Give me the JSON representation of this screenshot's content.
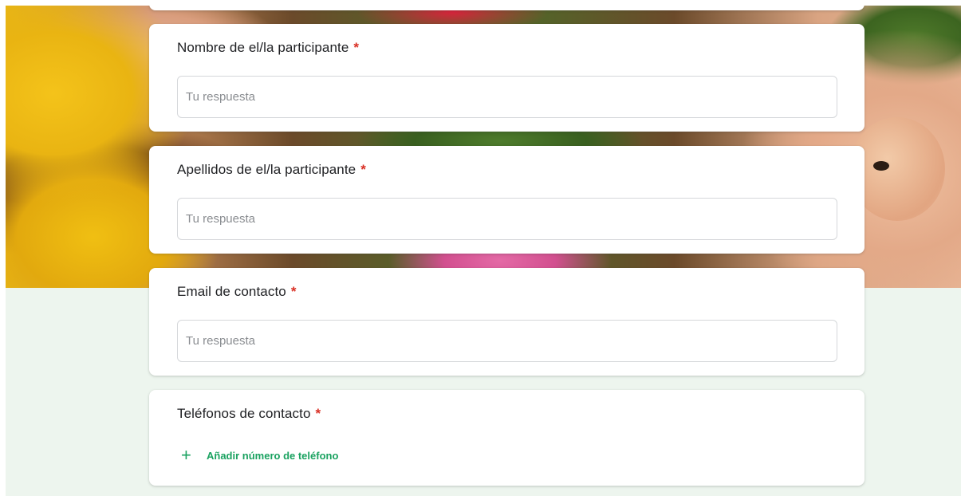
{
  "form": {
    "questions": [
      {
        "label": "Nombre de el/la participante",
        "required_mark": "*",
        "placeholder": "Tu respuesta"
      },
      {
        "label": "Apellidos de el/la participante",
        "required_mark": "*",
        "placeholder": "Tu respuesta"
      },
      {
        "label": "Email de contacto",
        "required_mark": "*",
        "placeholder": "Tu respuesta"
      },
      {
        "label": "Teléfonos de contacto",
        "required_mark": "*",
        "add_label": "Añadir número de teléfono",
        "add_icon": "plus-icon"
      }
    ]
  },
  "colors": {
    "required": "#d93025",
    "accent": "#1aa260",
    "page_background": "#edf5ee"
  }
}
